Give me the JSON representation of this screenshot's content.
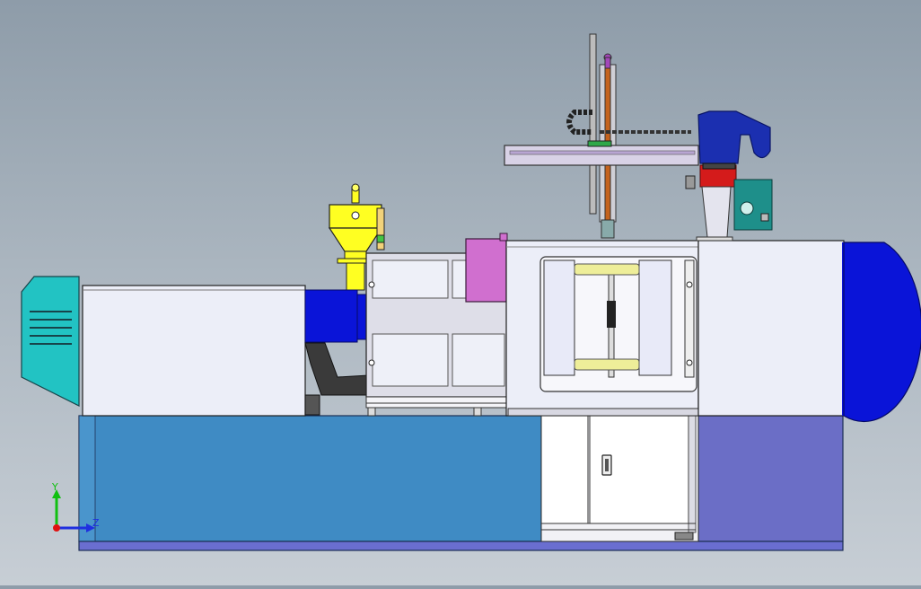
{
  "viewport": {
    "background_top": "#8e9ca9",
    "background_bottom": "#c7ced5"
  },
  "colors": {
    "base": "#3f8bc4",
    "base_right": "#6b6ec6",
    "base_rail": "#6a6ed0",
    "panel": "#eceef8",
    "barrel": "#0a14d8",
    "hopper": "#ffff22",
    "motor_housing": "#22c3c3",
    "magenta_block": "#d06fcf",
    "tie_bar": "#eeee99",
    "robot_head": "#1b2fb0",
    "robot_red": "#d41b1b",
    "robot_teal": "#1e8f8a"
  },
  "model": {
    "view": "side elevation",
    "parts": [
      "motor-housing",
      "injection-unit-cover",
      "hopper",
      "injection-barrel",
      "clamping-unit",
      "mold-platen",
      "tie-bars",
      "safety-door",
      "rear-clamp-cover",
      "machine-base",
      "gantry-robot"
    ]
  },
  "triad": {
    "y_label": "Y",
    "z_label": "Z",
    "y_color": "#11c011",
    "z_color": "#1f2fe0",
    "x_color": "#e01010"
  }
}
